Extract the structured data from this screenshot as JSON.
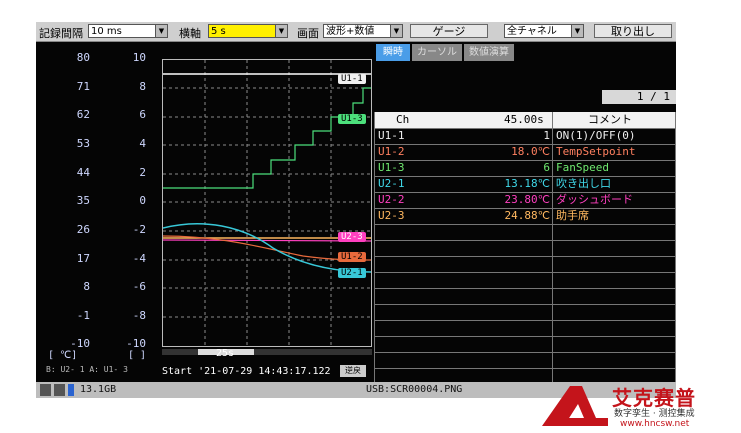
{
  "toolbar": {
    "record_interval_label": "記録間隔",
    "record_interval_value": "10 ms",
    "horizontal_axis_label": "横軸",
    "horizontal_axis_value": "5 s",
    "screen_label": "画面",
    "screen_value": "波形+数値",
    "gauge_button": "ゲージ",
    "channel_select": "全チャネル",
    "takeout_button": "取り出し"
  },
  "tabs": {
    "instant": "瞬時",
    "cursor": "カーソル",
    "calc": "数値演算"
  },
  "page_indicator": "1 / 1",
  "axis_a": [
    "80",
    "71",
    "62",
    "53",
    "44",
    "35",
    "26",
    "17",
    "8",
    "-1",
    "-10"
  ],
  "axis_b": [
    "10",
    "8",
    "6",
    "4",
    "2",
    "0",
    "-2",
    "-4",
    "-6",
    "-8",
    "-10"
  ],
  "axis_unit_a": "[  ℃]",
  "axis_unit_b": "[   ]",
  "axis_footer": "B:  U2- 1 A:  U1-  3",
  "time_label": "25s",
  "start_text": "Start '21-07-29 14:43:17.122",
  "stop_button": "逆戻",
  "channel_tags": {
    "u11": "U1-1",
    "u13": "U1-3",
    "u23": "U2-3",
    "u12": "U1-2",
    "u21": "U2-1"
  },
  "table": {
    "headers": {
      "ch": "Ch",
      "time": "45.00s",
      "comment": "コメント"
    },
    "rows": [
      {
        "ch": "U1-1",
        "value": "1",
        "comment": "ON(1)/OFF(0)",
        "color": "#f0f0f0"
      },
      {
        "ch": "U1-2",
        "value": "18.0℃",
        "comment": "TempSetpoint",
        "color": "#ff8060"
      },
      {
        "ch": "U1-3",
        "value": "6",
        "comment": "FanSpeed",
        "color": "#70e870"
      },
      {
        "ch": "U2-1",
        "value": "13.18℃",
        "comment": "吹き出し口",
        "color": "#40d8e8"
      },
      {
        "ch": "U2-2",
        "value": "23.80℃",
        "comment": "ダッシュボード",
        "color": "#ff40c0"
      },
      {
        "ch": "U2-3",
        "value": "24.88℃",
        "comment": "助手席",
        "color": "#ffb860"
      }
    ]
  },
  "status_bar": {
    "memory": "13.1GB",
    "file": "USB:SCR00004.PNG"
  },
  "watermark": {
    "title": "艾克赛普",
    "subtitle": "数字孪生 · 测控集成",
    "url": "www.hncsw.net"
  },
  "colors": {
    "u11": "#ffffff",
    "u12": "#e86a3c",
    "u13": "#4ce07c",
    "u21": "#38c8d8",
    "u22": "#ff40c0",
    "u23": "#ffb860",
    "accent": "#c4141b"
  }
}
